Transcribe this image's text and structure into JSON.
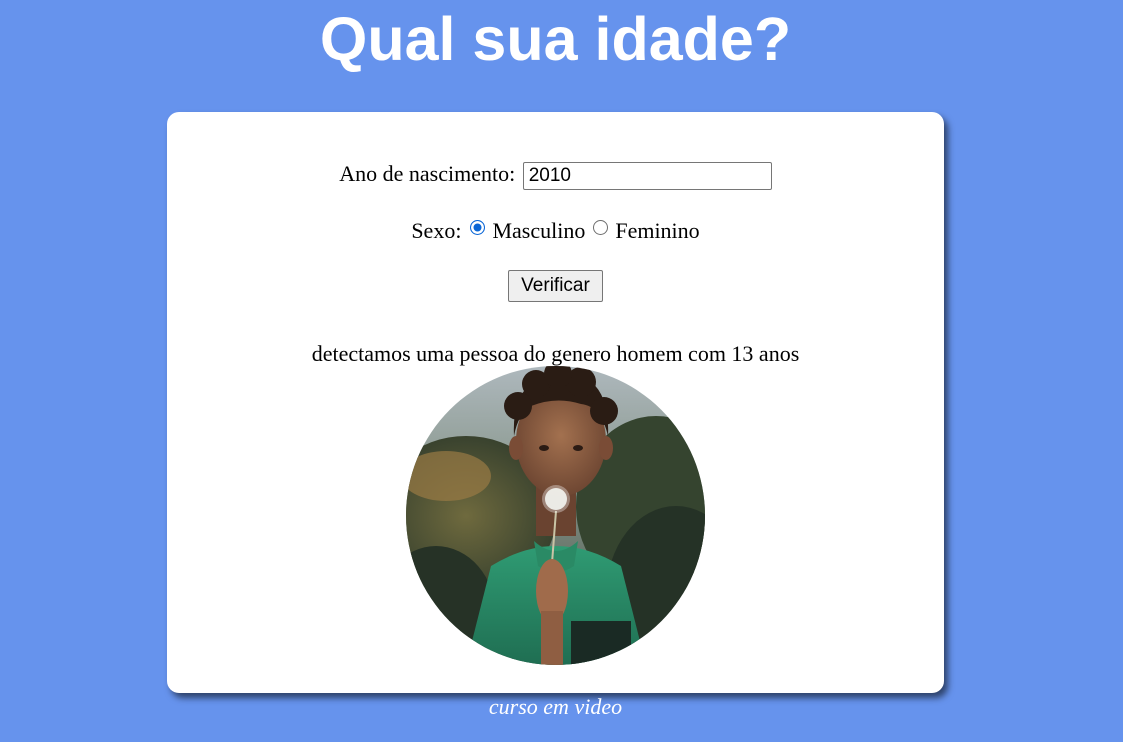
{
  "header": {
    "title": "Qual sua idade?"
  },
  "form": {
    "year_label": "Ano de nascimento:",
    "year_value": "2010",
    "sex_label": "Sexo:",
    "sex_options": [
      {
        "label": "Masculino",
        "checked": true
      },
      {
        "label": "Feminino",
        "checked": false
      }
    ],
    "verify_label": "Verificar"
  },
  "result": {
    "text": "detectamos uma pessoa do genero homem com 13 anos",
    "image": {
      "description_icon": "photo-boy-blowing-dandelion"
    }
  },
  "footer": {
    "text": "curso em video"
  },
  "colors": {
    "background": "#6693ed",
    "card": "#ffffff",
    "radio_accent": "#0a66d6"
  }
}
